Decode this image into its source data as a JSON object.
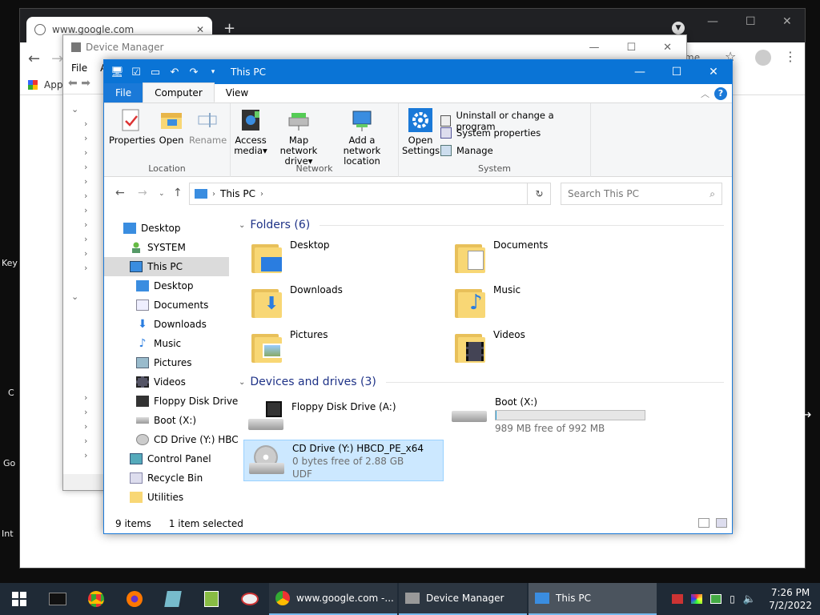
{
  "desktop": {
    "labels": [
      "Key",
      "C",
      "Go",
      "Int"
    ]
  },
  "chrome": {
    "tab_title": "www.google.com",
    "close": "✕",
    "new_tab": "+",
    "bookmark": "Apps",
    "profile_text": "me",
    "min": "—",
    "max": "☐",
    "close_win": "✕"
  },
  "devmgr": {
    "title": "Device Manager",
    "menu": [
      "File",
      "A"
    ],
    "min": "—",
    "max": "☐",
    "close": "✕"
  },
  "explorer": {
    "title": "This PC",
    "min": "—",
    "max": "☐",
    "close": "✕",
    "tabs": {
      "file": "File",
      "computer": "Computer",
      "view": "View"
    },
    "ribbon": {
      "location": {
        "label": "Location",
        "properties": "Properties",
        "open": "Open",
        "rename": "Rename"
      },
      "network": {
        "label": "Network",
        "access_media_1": "Access",
        "access_media_2": "media",
        "map_drive_1": "Map network",
        "map_drive_2": "drive",
        "add_loc_1": "Add a network",
        "add_loc_2": "location"
      },
      "system": {
        "label": "System",
        "open_settings_1": "Open",
        "open_settings_2": "Settings",
        "uninstall": "Uninstall or change a program",
        "sysprops": "System properties",
        "manage": "Manage"
      }
    },
    "address": {
      "path": "This PC",
      "search_placeholder": "Search This PC"
    },
    "nav": {
      "desktop": "Desktop",
      "system": "SYSTEM",
      "thispc": "This PC",
      "sub": [
        "Desktop",
        "Documents",
        "Downloads",
        "Music",
        "Pictures",
        "Videos",
        "Floppy Disk Drive",
        "Boot (X:)",
        "CD Drive (Y:) HBC"
      ],
      "control_panel": "Control Panel",
      "recycle_bin": "Recycle Bin",
      "utilities": "Utilities"
    },
    "folders_header": "Folders (6)",
    "folders": [
      "Desktop",
      "Documents",
      "Downloads",
      "Music",
      "Pictures",
      "Videos"
    ],
    "drives_header": "Devices and drives (3)",
    "drives": {
      "floppy": {
        "name": "Floppy Disk Drive (A:)"
      },
      "boot": {
        "name": "Boot (X:)",
        "free": "989 MB free of 992 MB",
        "used_fraction": 0.003
      },
      "cd": {
        "name": "CD Drive (Y:) HBCD_PE_x64",
        "free": "0 bytes free of 2.88 GB",
        "fs": "UDF"
      }
    },
    "status": {
      "items": "9 items",
      "selected": "1 item selected"
    }
  },
  "taskbar": {
    "tasks": [
      {
        "label": "www.google.com -..."
      },
      {
        "label": "Device Manager"
      },
      {
        "label": "This PC"
      }
    ],
    "time": "7:26 PM",
    "date": "7/2/2022"
  },
  "colors": {
    "accent": "#0a74d6",
    "selection": "#cce8ff",
    "taskbar": "#1f2a36",
    "folder": "#f8d775"
  }
}
